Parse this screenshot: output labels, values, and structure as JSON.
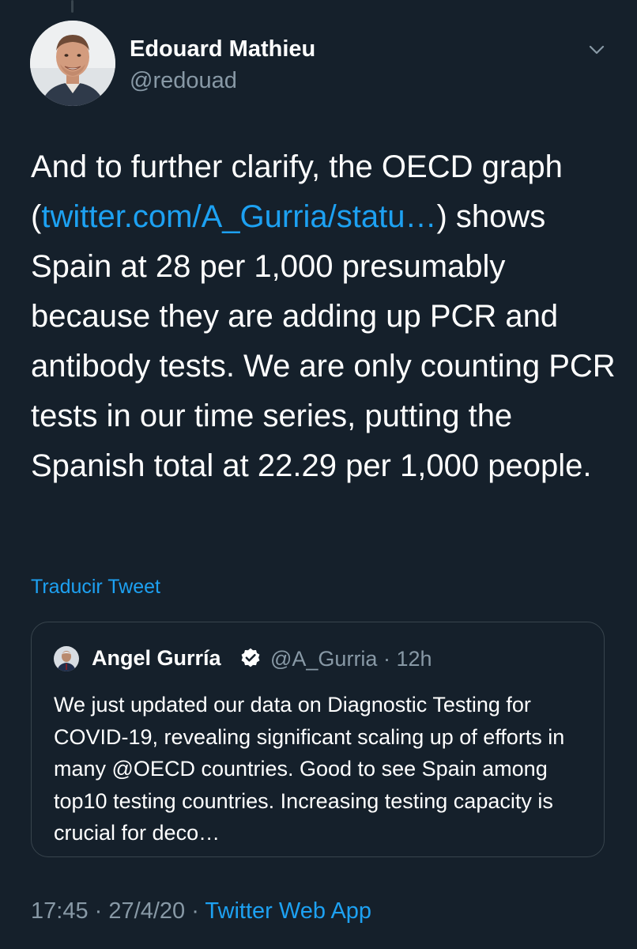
{
  "author": {
    "name": "Edouard Mathieu",
    "handle": "@redouad"
  },
  "tweet": {
    "text_before_link": "And to further clarify, the OECD graph (",
    "link_text": "twitter.com/A_Gurria/statu…",
    "text_after_link": ") shows Spain at 28 per 1,000 presumably because they are adding up PCR and antibody tests. We are only counting PCR tests in our time series, putting the Spanish total at 22.29 per 1,000 people."
  },
  "translate_label": "Traducir Tweet",
  "quoted_tweet": {
    "name": "Angel Gurría",
    "handle": "@A_Gurria",
    "separator": "·",
    "time": "12h",
    "verified": true,
    "text": "We just updated our data on Diagnostic Testing for COVID-19, revealing significant scaling up of efforts in many @OECD countries. Good to see Spain among top10 testing countries. Increasing testing capacity is crucial for deco…"
  },
  "footer": {
    "time": "17:45",
    "separator1": "·",
    "date": "27/4/20",
    "separator2": "·",
    "app": "Twitter Web App"
  },
  "icons": {
    "caret": "chevron-down-icon",
    "verified": "verified-badge-icon"
  },
  "colors": {
    "background": "#15202b",
    "link": "#1da1f2",
    "secondary_text": "#8899a6",
    "border": "#38444d",
    "primary_text": "#ffffff"
  }
}
